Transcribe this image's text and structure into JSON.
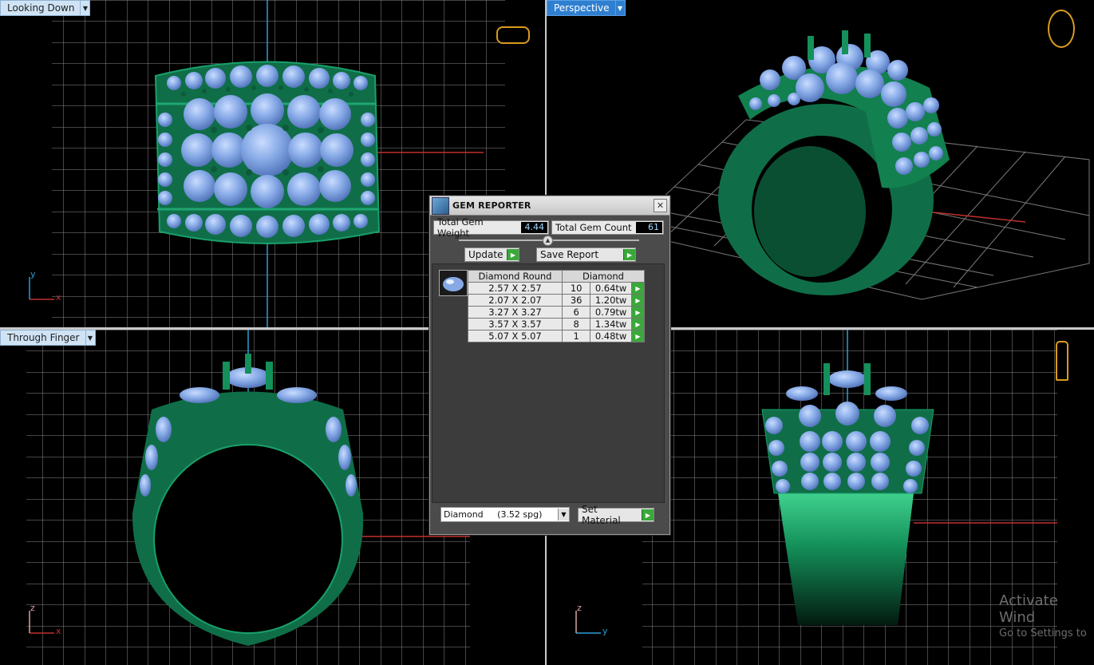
{
  "viewports": {
    "looking_down": {
      "label": "Looking Down"
    },
    "perspective": {
      "label": "Perspective"
    },
    "through_finger": {
      "label": "Through Finger"
    }
  },
  "gem_reporter": {
    "title": "GEM REPORTER",
    "total_gem_weight_label": "Total Gem Weight",
    "total_gem_weight": "4.44",
    "total_gem_count_label": "Total Gem Count",
    "total_gem_count": "61",
    "update_label": "Update",
    "save_report_label": "Save Report",
    "table": {
      "headers": [
        "Diamond Round",
        "Diamond"
      ],
      "rows": [
        {
          "size": "2.57 X 2.57",
          "count": "10",
          "weight": "0.64tw"
        },
        {
          "size": "2.07 X 2.07",
          "count": "36",
          "weight": "1.20tw"
        },
        {
          "size": "3.27 X 3.27",
          "count": "6",
          "weight": "0.79tw"
        },
        {
          "size": "3.57 X 3.57",
          "count": "8",
          "weight": "1.34tw"
        },
        {
          "size": "5.07 X 5.07",
          "count": "1",
          "weight": "0.48tw"
        }
      ]
    },
    "material_select": "Diamond     (3.52 spg)",
    "set_material_label": "Set Material"
  },
  "axes": {
    "x": "x",
    "y": "y",
    "z": "z"
  },
  "watermark": {
    "line1": "Activate Wind",
    "line2": "Go to Settings to"
  },
  "colors": {
    "metal": "#0f6e48",
    "gem": "#7fa6e6",
    "grid": "#8a8a8a",
    "axis_red": "#c0302c",
    "axis_blue": "#2a9fd6",
    "selected_label": "#2f7fd0"
  }
}
